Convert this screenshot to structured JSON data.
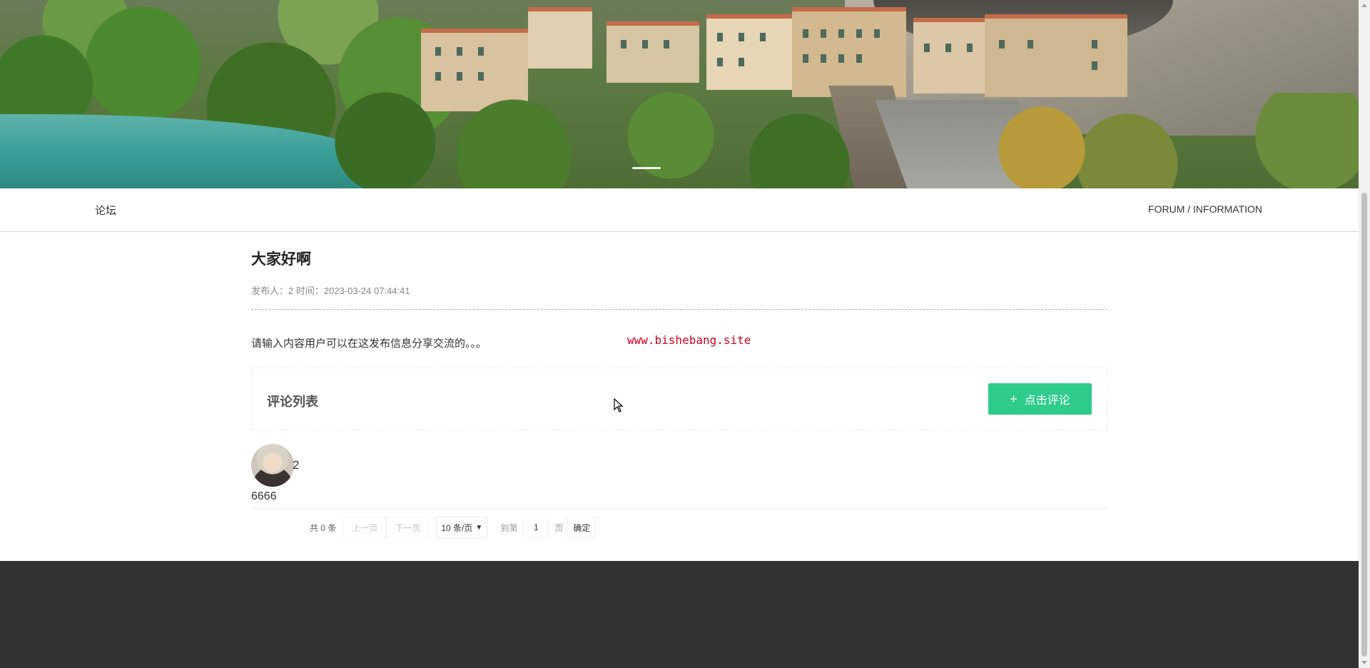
{
  "breadcrumb": {
    "left": "论坛",
    "right": "FORUM / INFORMATION"
  },
  "post": {
    "title": "大家好啊",
    "author_label": "发布人：",
    "author": "2",
    "time_label": "时间：",
    "time": "2023-03-24 07:44:41",
    "content": "请输入内容用户可以在这发布信息分享交流的。。。"
  },
  "watermark": "www.bishebang.site",
  "comments": {
    "header": "评论列表",
    "add_button": "点击评论",
    "items": [
      {
        "user": "2",
        "text": "6666"
      }
    ]
  },
  "pagination": {
    "total": "共 0 条",
    "prev": "上一页",
    "next": "下一页",
    "page_size": "10 条/页",
    "goto_label": "到第",
    "page_value": "1",
    "page_suffix": "页",
    "confirm": "确定"
  },
  "colors": {
    "accent": "#2ecb8a",
    "footer": "#323232",
    "watermark": "#d0021b"
  },
  "icons": {
    "add": "plus-icon",
    "page_size": "chevron-down-icon",
    "scroll_up": "scroll-up-icon",
    "scroll_down": "scroll-down-icon",
    "cursor": "mouse-cursor-icon"
  }
}
